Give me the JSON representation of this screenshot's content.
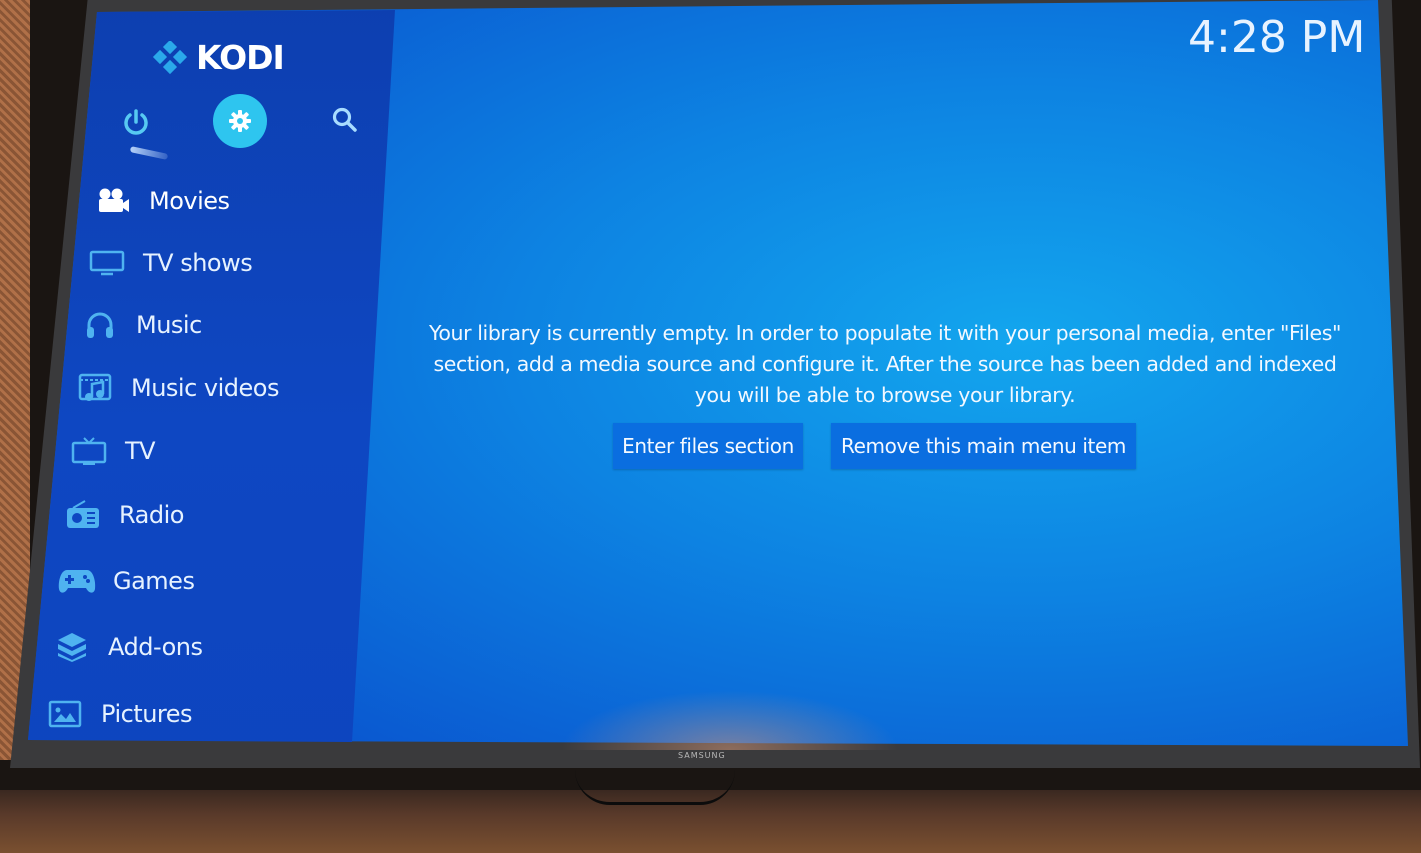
{
  "app": {
    "name": "KODI"
  },
  "clock": "4:28 PM",
  "top_controls": [
    {
      "name": "power",
      "icon": "power-icon"
    },
    {
      "name": "settings",
      "icon": "gear-icon",
      "focused": true
    },
    {
      "name": "search",
      "icon": "search-icon"
    }
  ],
  "sidebar": {
    "items": [
      {
        "label": "Movies",
        "icon": "movie-camera-icon",
        "active": true
      },
      {
        "label": "TV shows",
        "icon": "monitor-icon"
      },
      {
        "label": "Music",
        "icon": "headphones-icon"
      },
      {
        "label": "Music videos",
        "icon": "music-video-icon"
      },
      {
        "label": "TV",
        "icon": "tv-icon"
      },
      {
        "label": "Radio",
        "icon": "radio-icon"
      },
      {
        "label": "Games",
        "icon": "gamepad-icon"
      },
      {
        "label": "Add-ons",
        "icon": "addons-box-icon"
      },
      {
        "label": "Pictures",
        "icon": "picture-icon"
      }
    ]
  },
  "main": {
    "message": "Your library is currently empty. In order to populate it with your personal media, enter \"Files\" section, add a media source and configure it. After the source has been added and indexed you will be able to browse your library.",
    "buttons": {
      "enter_files": "Enter files section",
      "remove_item": "Remove this main menu item"
    }
  },
  "tv": {
    "brand": "SAMSUNG"
  },
  "colors": {
    "accent": "#2ec5ef",
    "button": "#0a6ee0",
    "sidebar": "#0e47c2",
    "background": "#0d83e2"
  }
}
